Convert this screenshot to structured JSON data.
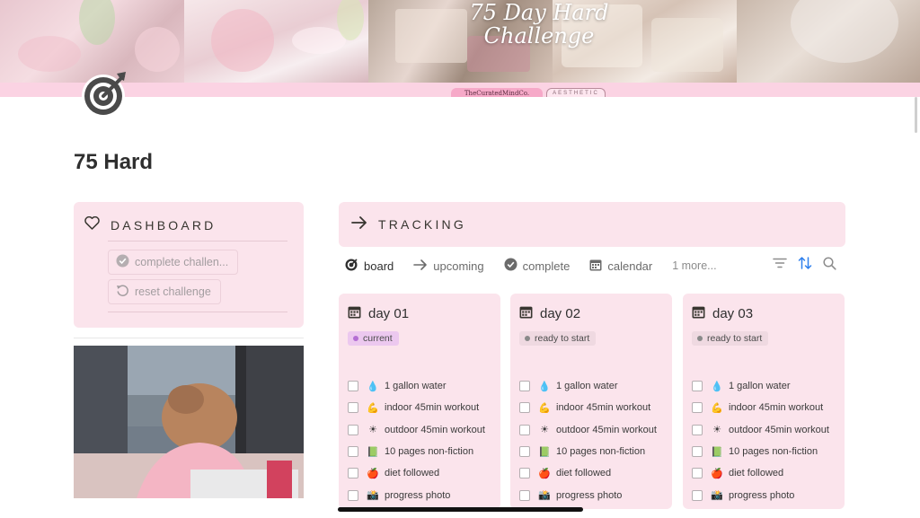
{
  "banner": {
    "title_line1": "75 Day Hard",
    "title_line2": "Challenge",
    "brand_chip": "TheCuratedMindCo.",
    "aesthetic_chip": "AESTHETIC"
  },
  "page": {
    "icon": "target-icon",
    "title": "75 Hard"
  },
  "dashboard": {
    "label": "DASHBOARD",
    "icon": "heart-icon",
    "buttons": [
      {
        "label": "complete challen...",
        "icon": "check-circle-icon"
      },
      {
        "label": "reset challenge",
        "icon": "reset-icon"
      }
    ]
  },
  "tracking": {
    "label": "TRACKING",
    "icon": "arrow-right-icon",
    "views": [
      {
        "label": "board",
        "icon": "target-icon",
        "active": true
      },
      {
        "label": "upcoming",
        "icon": "arrow-right-icon",
        "active": false
      },
      {
        "label": "complete",
        "icon": "check-circle-icon",
        "active": false
      },
      {
        "label": "calendar",
        "icon": "calendar-icon",
        "active": false
      }
    ],
    "more_label": "1 more...",
    "tools": [
      "filter-icon",
      "sort-icon",
      "search-icon"
    ],
    "accent_color": "#2f80ed"
  },
  "cards": [
    {
      "title": "day 01",
      "status": "current",
      "status_color": "#b46fd3",
      "status_bg": "#ecc8ef",
      "tasks": [
        {
          "emoji": "💧",
          "label": "1 gallon water"
        },
        {
          "emoji": "💪",
          "label": "indoor 45min workout"
        },
        {
          "emoji": "☀",
          "label": "outdoor 45min workout"
        },
        {
          "emoji": "📗",
          "label": "10 pages non-fiction"
        },
        {
          "emoji": "🍎",
          "label": "diet followed"
        },
        {
          "emoji": "📸",
          "label": "progress photo"
        }
      ]
    },
    {
      "title": "day 02",
      "status": "ready to start",
      "status_color": "#8a8a8a",
      "status_bg": "#efd9e1",
      "tasks": [
        {
          "emoji": "💧",
          "label": "1 gallon water"
        },
        {
          "emoji": "💪",
          "label": "indoor 45min workout"
        },
        {
          "emoji": "☀",
          "label": "outdoor 45min workout"
        },
        {
          "emoji": "📗",
          "label": "10 pages non-fiction"
        },
        {
          "emoji": "🍎",
          "label": "diet followed"
        },
        {
          "emoji": "📸",
          "label": "progress photo"
        }
      ]
    },
    {
      "title": "day 03",
      "status": "ready to start",
      "status_color": "#8a8a8a",
      "status_bg": "#efd9e1",
      "tasks": [
        {
          "emoji": "💧",
          "label": "1 gallon water"
        },
        {
          "emoji": "💪",
          "label": "indoor 45min workout"
        },
        {
          "emoji": "☀",
          "label": "outdoor 45min workout"
        },
        {
          "emoji": "📗",
          "label": "10 pages non-fiction"
        },
        {
          "emoji": "🍎",
          "label": "diet followed"
        },
        {
          "emoji": "📸",
          "label": "progress photo"
        }
      ]
    }
  ]
}
